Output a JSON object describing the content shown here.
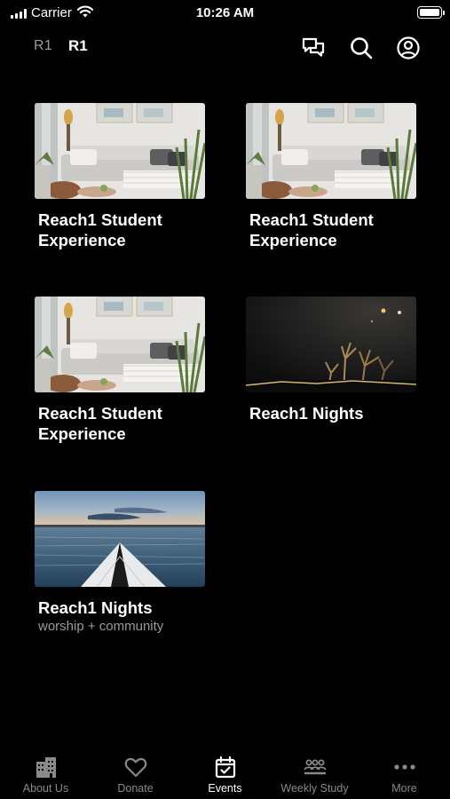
{
  "status_bar": {
    "carrier": "Carrier",
    "time": "10:26 AM"
  },
  "top_nav": {
    "tabs": [
      "R1",
      "R1"
    ],
    "icons": [
      "chat-icon",
      "search-icon",
      "profile-icon"
    ]
  },
  "cards": [
    {
      "title": "Reach1 Student Experience",
      "subtitle": "",
      "image": "living-room-photo"
    },
    {
      "title": "Reach1 Student Experience",
      "subtitle": "",
      "image": "living-room-photo"
    },
    {
      "title": "Reach1 Student Experience",
      "subtitle": "",
      "image": "living-room-photo"
    },
    {
      "title": "Reach1 Nights",
      "subtitle": "",
      "image": "concert-hands-photo"
    },
    {
      "title": "Reach1 Nights",
      "subtitle": "worship + community",
      "image": "kayak-lake-photo"
    }
  ],
  "tab_bar": {
    "active": "Events",
    "items": [
      {
        "label": "About Us",
        "icon": "building-icon"
      },
      {
        "label": "Donate",
        "icon": "heart-icon"
      },
      {
        "label": "Events",
        "icon": "calendar-icon"
      },
      {
        "label": "Weekly Study",
        "icon": "group-icon"
      },
      {
        "label": "More",
        "icon": "more-icon"
      }
    ]
  },
  "colors": {
    "background": "#000000",
    "text": "#ffffff",
    "muted": "#9a9a9a"
  }
}
